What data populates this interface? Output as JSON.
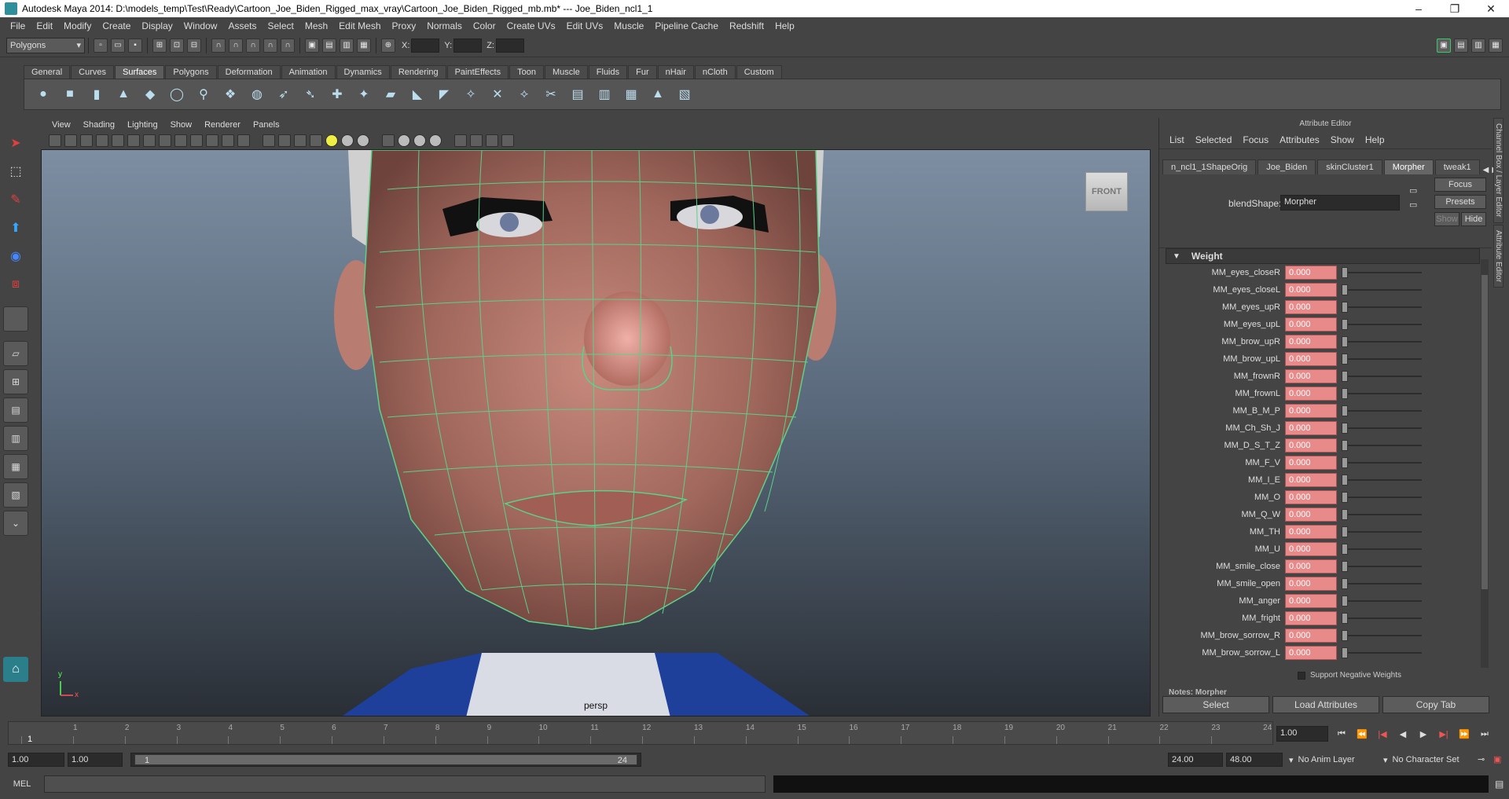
{
  "window": {
    "title": "Autodesk Maya 2014: D:\\models_temp\\Test\\Ready\\Cartoon_Joe_Biden_Rigged_max_vray\\Cartoon_Joe_Biden_Rigged_mb.mb*  ---  Joe_Biden_ncl1_1",
    "minimize": "–",
    "maximize": "❐",
    "close": "✕"
  },
  "menubar": [
    "File",
    "Edit",
    "Modify",
    "Create",
    "Display",
    "Window",
    "Assets",
    "Select",
    "Mesh",
    "Edit Mesh",
    "Proxy",
    "Normals",
    "Color",
    "Create UVs",
    "Edit UVs",
    "Muscle",
    "Pipeline Cache",
    "Redshift",
    "Help"
  ],
  "statusline": {
    "mode": "Polygons",
    "x_label": "X:",
    "y_label": "Y:",
    "z_label": "Z:"
  },
  "shelf": {
    "tabs": [
      "General",
      "Curves",
      "Surfaces",
      "Polygons",
      "Deformation",
      "Animation",
      "Dynamics",
      "Rendering",
      "PaintEffects",
      "Toon",
      "Muscle",
      "Fluids",
      "Fur",
      "nHair",
      "nCloth",
      "Custom"
    ],
    "active_tab": "Surfaces"
  },
  "viewport": {
    "menu": [
      "View",
      "Shading",
      "Lighting",
      "Show",
      "Renderer",
      "Panels"
    ],
    "camera": "persp",
    "view_cube_label": "FRONT",
    "axis_x": "x",
    "axis_y": "y"
  },
  "attribute_editor": {
    "title": "Attribute Editor",
    "menu": [
      "List",
      "Selected",
      "Focus",
      "Attributes",
      "Show",
      "Help"
    ],
    "tabs": [
      "n_ncl1_1ShapeOrig",
      "Joe_Biden",
      "skinCluster1",
      "Morpher",
      "tweak1"
    ],
    "active_tab": "Morpher",
    "blendshape_label": "blendShape:",
    "blendshape_value": "Morpher",
    "focus_button": "Focus",
    "presets_button": "Presets",
    "show_button": "Show",
    "hide_button": "Hide",
    "weight_section": "Weight",
    "weights": [
      {
        "name": "MM_eyes_closeR",
        "value": "0.000"
      },
      {
        "name": "MM_eyes_closeL",
        "value": "0.000"
      },
      {
        "name": "MM_eyes_upR",
        "value": "0.000"
      },
      {
        "name": "MM_eyes_upL",
        "value": "0.000"
      },
      {
        "name": "MM_brow_upR",
        "value": "0.000"
      },
      {
        "name": "MM_brow_upL",
        "value": "0.000"
      },
      {
        "name": "MM_frownR",
        "value": "0.000"
      },
      {
        "name": "MM_frownL",
        "value": "0.000"
      },
      {
        "name": "MM_B_M_P",
        "value": "0.000"
      },
      {
        "name": "MM_Ch_Sh_J",
        "value": "0.000"
      },
      {
        "name": "MM_D_S_T_Z",
        "value": "0.000"
      },
      {
        "name": "MM_F_V",
        "value": "0.000"
      },
      {
        "name": "MM_I_E",
        "value": "0.000"
      },
      {
        "name": "MM_O",
        "value": "0.000"
      },
      {
        "name": "MM_Q_W",
        "value": "0.000"
      },
      {
        "name": "MM_TH",
        "value": "0.000"
      },
      {
        "name": "MM_U",
        "value": "0.000"
      },
      {
        "name": "MM_smile_close",
        "value": "0.000"
      },
      {
        "name": "MM_smile_open",
        "value": "0.000"
      },
      {
        "name": "MM_anger",
        "value": "0.000"
      },
      {
        "name": "MM_fright",
        "value": "0.000"
      },
      {
        "name": "MM_brow_sorrow_R",
        "value": "0.000"
      },
      {
        "name": "MM_brow_sorrow_L",
        "value": "0.000"
      }
    ],
    "support_negative": "Support Negative Weights",
    "notes_label": "Notes: Morpher",
    "buttons": {
      "select": "Select",
      "load_attributes": "Load Attributes",
      "copy_tab": "Copy Tab"
    }
  },
  "side_dock": {
    "channel_box": "Channel Box / Layer Editor",
    "attribute_editor": "Attribute Editor"
  },
  "timeline": {
    "frames": [
      "1",
      "2",
      "3",
      "4",
      "5",
      "6",
      "7",
      "8",
      "9",
      "10",
      "11",
      "12",
      "13",
      "14",
      "15",
      "16",
      "17",
      "18",
      "19",
      "20",
      "21",
      "22",
      "23",
      "24"
    ],
    "current_frame_label": "1",
    "current_frame": "1.00"
  },
  "range": {
    "start": "1.00",
    "playback_start": "1.00",
    "range_start_label": "1",
    "range_end_label": "24",
    "playback_end": "24.00",
    "end": "48.00",
    "anim_layer": "No Anim Layer",
    "character_set": "No Character Set"
  },
  "cmdline": {
    "language": "MEL"
  }
}
